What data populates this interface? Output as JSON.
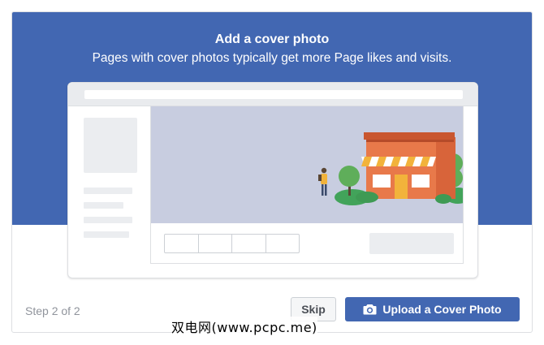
{
  "dialog": {
    "title": "Add a cover photo",
    "subtitle": "Pages with cover photos typically get more Page likes and visits.",
    "step_text": "Step 2 of 2",
    "skip_label": "Skip",
    "upload_label": "Upload a Cover Photo",
    "upload_icon": "camera-icon",
    "illustration": "storefront-illustration"
  },
  "colors": {
    "banner": "#4267b2",
    "primary_button": "#4267b2",
    "secondary_button": "#f5f6f7",
    "preview_cover": "#c8cde0",
    "placeholder": "#ebedf0"
  },
  "watermark": "双电网(www.pcpc.me)"
}
